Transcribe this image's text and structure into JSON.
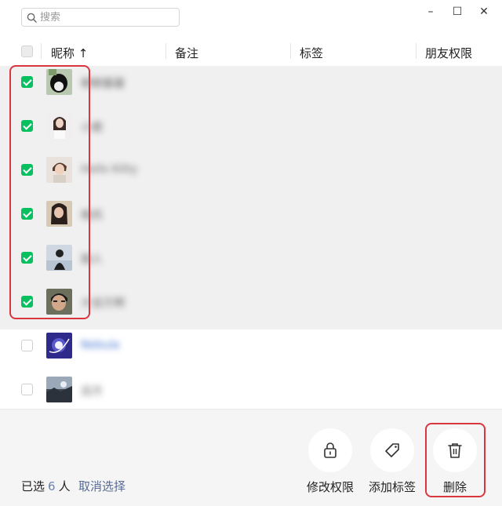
{
  "search": {
    "placeholder": "搜索"
  },
  "window_controls": {
    "minimize": "–",
    "maximize": "☐",
    "close": "✕"
  },
  "table": {
    "columns": [
      "昵称 ↑",
      "备注",
      "标签",
      "朋友权限"
    ],
    "rows": [
      {
        "nickname": "朝朝暮暮",
        "selected": true
      },
      {
        "nickname": "小鹿",
        "selected": true
      },
      {
        "nickname": "Hello Kitty",
        "selected": true
      },
      {
        "nickname": "晚风",
        "selected": true
      },
      {
        "nickname": "路人",
        "selected": true
      },
      {
        "nickname": "大宝贝啊",
        "selected": true
      },
      {
        "nickname": "Nebula",
        "selected": false
      },
      {
        "nickname": "远方",
        "selected": false
      }
    ]
  },
  "footer": {
    "selected_prefix": "已选",
    "selected_count": "6",
    "selected_unit": "人",
    "cancel_label": "取消选择",
    "actions": [
      {
        "label": "修改权限",
        "icon": "lock-icon"
      },
      {
        "label": "添加标签",
        "icon": "tag-icon"
      },
      {
        "label": "删除",
        "icon": "trash-icon"
      }
    ]
  },
  "colors": {
    "accent_green": "#07c160",
    "highlight_red": "#d9363e",
    "link_blue": "#576b95"
  }
}
